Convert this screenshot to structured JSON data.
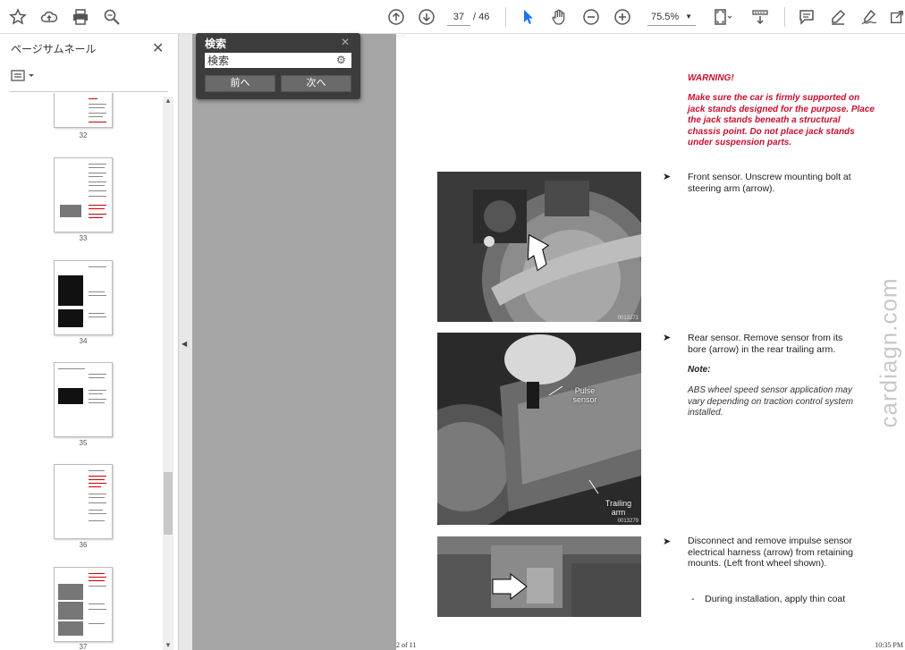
{
  "toolbar": {
    "page_current": "37",
    "page_total": "/ 46",
    "zoom": "75.5%"
  },
  "sidebar": {
    "title": "ページサムネール",
    "close": "✕",
    "thumbnails": [
      {
        "label": "32"
      },
      {
        "label": "33"
      },
      {
        "label": "34"
      },
      {
        "label": "35"
      },
      {
        "label": "36"
      },
      {
        "label": "37"
      }
    ]
  },
  "find": {
    "title": "検索",
    "close": "✕",
    "value": "検索",
    "prev_label": "前へ",
    "next_label": "次へ"
  },
  "document": {
    "warning_title": "WARNING!",
    "warning_body": "Make sure the car is firmly supported on jack stands designed for the purpose. Place the jack stands beneath a structural chassis point. Do not place jack stands under suspension parts.",
    "step1": "Front sensor. Unscrew mounting bolt at steering arm (arrow).",
    "photo1_code": "0013271",
    "step2": "Rear sensor. Remove sensor from its bore (arrow) in the rear trailing arm.",
    "photo2_label_pulse": "Pulse sensor",
    "photo2_label_trailing": "Trailing arm",
    "photo2_code": "0013279",
    "note_title": "Note:",
    "note_body": "ABS wheel speed sensor application may vary depending on traction control system installed.",
    "step3": "Disconnect and remove impulse sensor electrical harness (arrow) from retaining mounts. (Left front wheel shown).",
    "dash_item": "During installation, apply thin coat",
    "footer_left": "2 of 11",
    "footer_right": "10:35 PM",
    "watermark": "cardiagn.com"
  },
  "colors": {
    "warning": "#c8102e",
    "workspace": "#a5a5a5",
    "find_bg": "#3c3c3c",
    "accent_blue": "#1a73e8"
  }
}
